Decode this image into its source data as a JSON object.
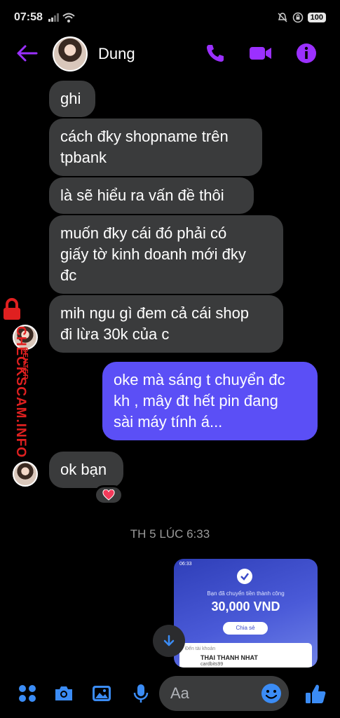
{
  "status_bar": {
    "time": "07:58",
    "battery": "100"
  },
  "header": {
    "contact_name": "Dung"
  },
  "messages": [
    {
      "direction": "in",
      "lines": [
        "ghi"
      ]
    },
    {
      "direction": "in",
      "lines": [
        "cách đky shopname trên",
        "tpbank"
      ]
    },
    {
      "direction": "in",
      "lines": [
        "là sẽ hiểu ra vấn đề thôi"
      ]
    },
    {
      "direction": "in",
      "lines": [
        "muốn đky cái đó phải có",
        "giấy tờ kinh doanh mới đky",
        "đc"
      ]
    },
    {
      "direction": "in",
      "lines": [
        "mih ngu gì đem cả cái shop",
        "đi lừa 30k của c"
      ]
    },
    {
      "direction": "out",
      "lines": [
        "oke mà sáng t chuyển đc",
        "kh , mây đt hết pin đang",
        "sài máy tính á..."
      ]
    },
    {
      "direction": "in",
      "lines": [
        "ok bạn"
      ]
    }
  ],
  "reaction": "heart",
  "timestamp": "TH 5 LÚC 6:33",
  "attachment": {
    "status_time": "06:33",
    "line1": "Bạn đã chuyển tiền thành công",
    "amount": "30,000 VND",
    "share_label": "Chia sẻ",
    "to_label": "Đến tài khoản",
    "recipient": "THAI THANH NHAT",
    "recipient_sub": "cardbits99"
  },
  "watermark": {
    "main": "CHECKSCAM.INFO",
    "sub": "CENTER"
  },
  "composer": {
    "placeholder": "Aa"
  },
  "colors": {
    "accent": "#9b30ff",
    "outgoing_bubble": "#5b4ff6",
    "incoming_bubble": "#3a3b3c",
    "bottom_icons": "#3b8cf5",
    "watermark": "#e02020"
  }
}
